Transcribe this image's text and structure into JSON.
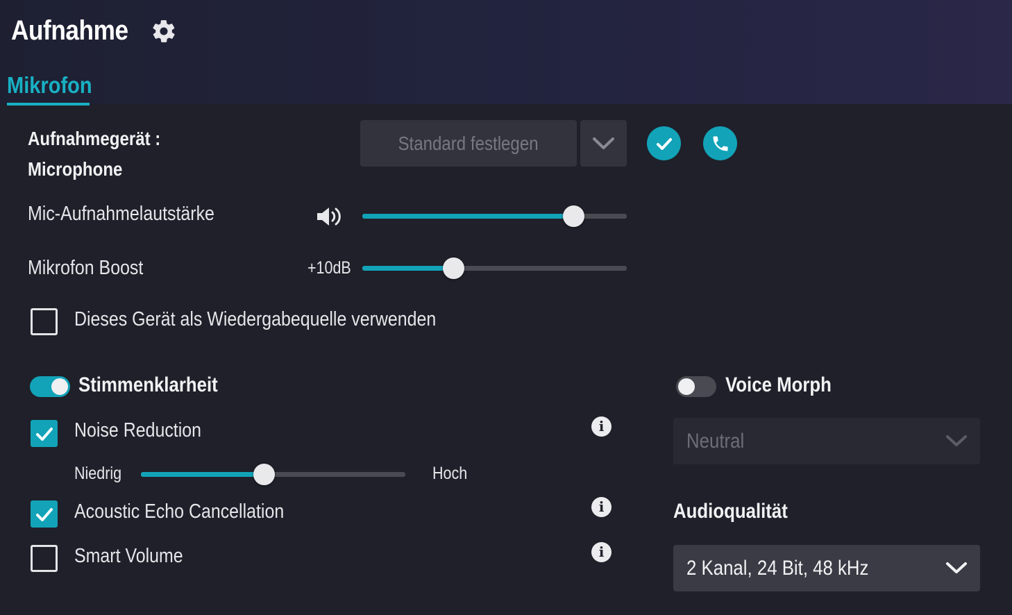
{
  "header": {
    "title": "Aufnahme",
    "settings_icon": "gear-icon",
    "tab": "Mikrofon"
  },
  "device": {
    "label_line1": "Aufnahmegerät :",
    "label_line2": "Microphone",
    "default_button": "Standard festlegen",
    "check_icon": "check-icon",
    "call_icon": "phone-icon"
  },
  "mic_volume": {
    "label": "Mic-Aufnahmelautstärke",
    "icon": "speaker-icon",
    "value_fraction": 0.8
  },
  "mic_boost": {
    "label": "Mikrofon Boost",
    "value_label": "+10dB",
    "value_fraction": 0.345
  },
  "playback_source": {
    "label": "Dieses Gerät als Wiedergabequelle verwenden",
    "checked": false
  },
  "voice_clarity": {
    "label": "Stimmenklarheit",
    "enabled": true,
    "noise_reduction": {
      "label": "Noise Reduction",
      "checked": true
    },
    "level": {
      "low": "Niedrig",
      "high": "Hoch",
      "value_fraction": 0.465
    },
    "echo_cancellation": {
      "label": "Acoustic Echo Cancellation",
      "checked": true
    },
    "smart_volume": {
      "label": "Smart Volume",
      "checked": false
    }
  },
  "voice_morph": {
    "label": "Voice Morph",
    "enabled": false,
    "preset": "Neutral"
  },
  "audio_quality": {
    "label": "Audioqualität",
    "value": "2 Kanal, 24 Bit, 48 kHz"
  },
  "colors": {
    "accent": "#12a3b8",
    "tab_accent": "#19b0c4",
    "background": "#1f2029",
    "control_bg": "#32333c"
  }
}
